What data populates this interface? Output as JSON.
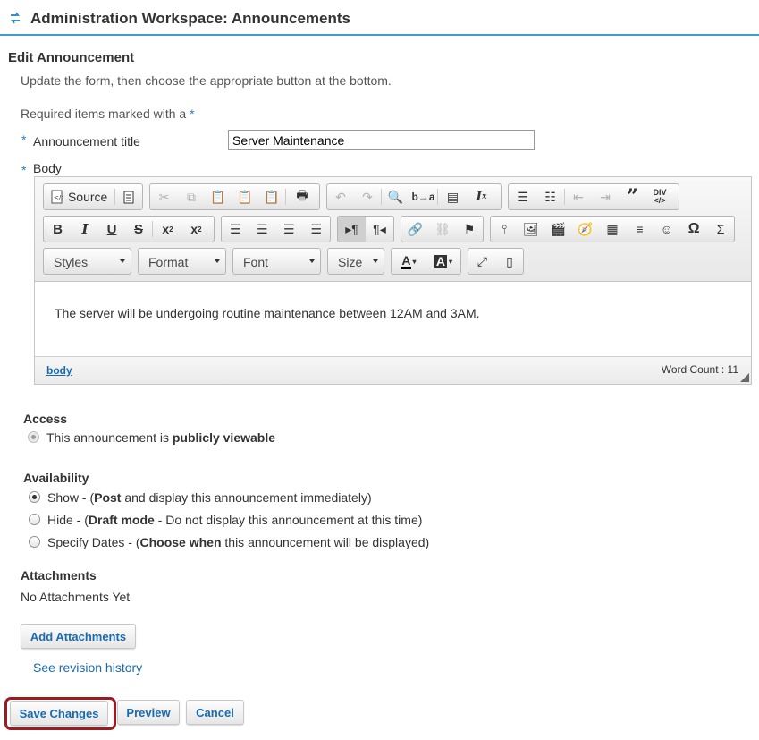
{
  "header": {
    "title": "Administration Workspace: Announcements",
    "icon": "swap-arrows-icon"
  },
  "form": {
    "heading": "Edit Announcement",
    "instruction": "Update the form, then choose the appropriate button at the bottom.",
    "required_note": "Required items marked with a",
    "required_star": "*",
    "title_label": "Announcement title",
    "title_value": "Server Maintenance",
    "body_label": "Body"
  },
  "editor": {
    "source_label": "Source",
    "combos": {
      "styles": "Styles",
      "format": "Format",
      "font": "Font",
      "size": "Size"
    },
    "content": "The server will be undergoing routine maintenance between 12AM and 3AM.",
    "path": "body",
    "word_count": "Word Count : 11"
  },
  "access": {
    "heading": "Access",
    "text_prefix": "This announcement is",
    "text_bold": "publicly viewable"
  },
  "availability": {
    "heading": "Availability",
    "options": [
      {
        "pre": "Show - (",
        "bold": "Post",
        "post": " and display this announcement immediately)",
        "checked": true
      },
      {
        "pre": "Hide - (",
        "bold": "Draft mode",
        "post": " - Do not display this announcement at this time)",
        "checked": false
      },
      {
        "pre": "Specify Dates - (",
        "bold": "Choose when",
        "post": " this announcement will be displayed)",
        "checked": false
      }
    ]
  },
  "attachments": {
    "heading": "Attachments",
    "empty": "No Attachments Yet",
    "add_button": "Add Attachments"
  },
  "revision_link": "See revision history",
  "actions": {
    "save": "Save Changes",
    "preview": "Preview",
    "cancel": "Cancel"
  },
  "colors": {
    "accent": "#3a9fce",
    "link": "#1a6ab0",
    "highlight": "#9b1b20"
  }
}
